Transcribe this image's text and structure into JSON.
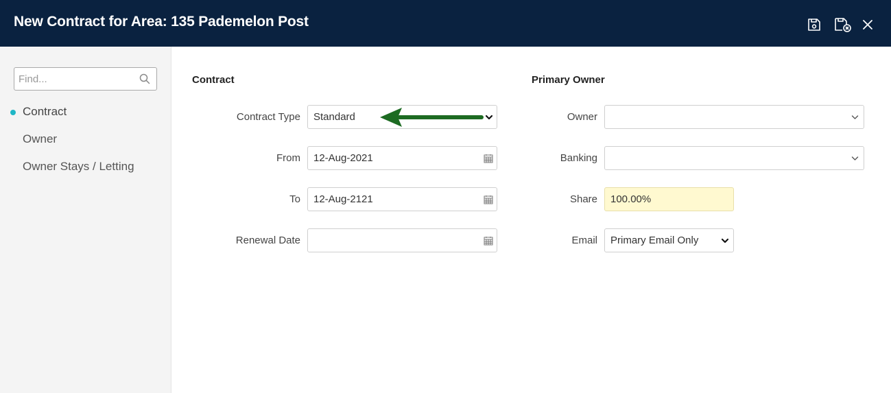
{
  "header": {
    "title": "New Contract for Area: 135 Pademelon Post",
    "save_icon": "save-icon",
    "save_close_icon": "save-close-icon",
    "close_icon": "close-icon"
  },
  "sidebar": {
    "find_placeholder": "Find...",
    "items": [
      {
        "label": "Contract",
        "active": true
      },
      {
        "label": "Owner",
        "active": false
      },
      {
        "label": "Owner Stays / Letting",
        "active": false
      }
    ]
  },
  "contract": {
    "section_title": "Contract",
    "contract_type_label": "Contract Type",
    "contract_type_value": "Standard",
    "from_label": "From",
    "from_value": "12-Aug-2021",
    "to_label": "To",
    "to_value": "12-Aug-2121",
    "renewal_label": "Renewal Date",
    "renewal_value": ""
  },
  "primary_owner": {
    "section_title": "Primary Owner",
    "owner_label": "Owner",
    "owner_value": "",
    "banking_label": "Banking",
    "banking_value": "",
    "share_label": "Share",
    "share_value": "100.00%",
    "email_label": "Email",
    "email_value": "Primary Email Only"
  },
  "colors": {
    "header_bg": "#0a2240",
    "active_dot": "#1fb6c6",
    "share_bg": "#fff9d0",
    "arrow": "#1d6b22"
  }
}
